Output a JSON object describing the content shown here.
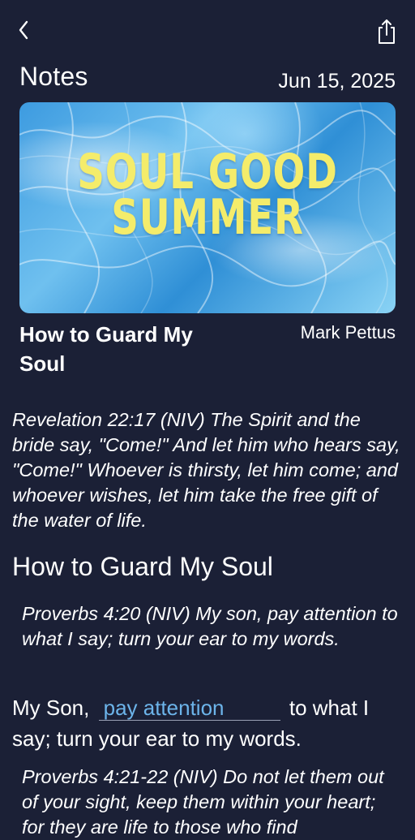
{
  "header": {
    "back_icon": "chevron-left-icon",
    "share_icon": "share-icon"
  },
  "notes": {
    "title": "Notes",
    "date": "Jun 15, 2025"
  },
  "banner": {
    "line1": "SOUL GOOD",
    "line2": "SUMMER",
    "text_color": "#f4ec6b",
    "water_color": "#3d9be0"
  },
  "sermon": {
    "title": "How to Guard My Soul",
    "speaker": "Mark Pettus"
  },
  "content": {
    "verse1": "Revelation 22:17 (NIV) The Spirit and the bride say, \"Come!\" And let him who hears say, \"Come!\" Whoever is thirsty, let him come; and whoever wishes, let him take the free gift of the water of life.",
    "heading": "How to Guard My Soul",
    "verse2": "Proverbs 4:20 (NIV) My son, pay attention to what I say; turn your ear to my words.",
    "fill_prefix": "My Son,",
    "fill_answer": "pay attention",
    "fill_suffix": "to what I say; turn your ear to my words.",
    "verse3": "Proverbs 4:21-22 (NIV) Do not let them out of your sight, keep them within your heart; for they are life to those who find"
  },
  "colors": {
    "background": "#1b2036",
    "answer": "#6cb4ea"
  }
}
